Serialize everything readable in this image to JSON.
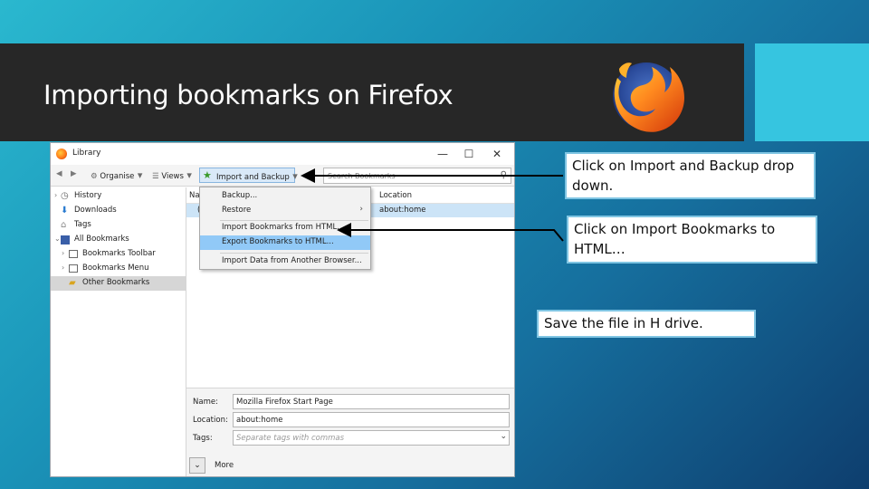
{
  "slide": {
    "title": "Importing bookmarks on Firefox"
  },
  "window": {
    "title": "Library",
    "controls": {
      "minimize": "—",
      "maximize": "☐",
      "close": "✕"
    },
    "toolbar": {
      "back": "◀",
      "forward": "▶",
      "organise_label": "Organise",
      "views_label": "Views",
      "import_label": "Import and Backup",
      "search_placeholder": "Search Bookmarks"
    },
    "sidebar": {
      "items": [
        {
          "label": "History"
        },
        {
          "label": "Downloads"
        },
        {
          "label": "Tags"
        },
        {
          "label": "All Bookmarks"
        },
        {
          "label": "Bookmarks Toolbar"
        },
        {
          "label": "Bookmarks Menu"
        },
        {
          "label": "Other Bookmarks"
        }
      ]
    },
    "list": {
      "col_name": "Na",
      "col_location": "Location",
      "row_name": "(",
      "row_location": "about:home"
    },
    "menu": {
      "items": [
        {
          "label": "Backup..."
        },
        {
          "label": "Restore"
        },
        {
          "label": "Import Bookmarks from HTML..."
        },
        {
          "label": "Export Bookmarks to HTML..."
        },
        {
          "label": "Import Data from Another Browser..."
        }
      ],
      "submenu_arrow": "›"
    },
    "details": {
      "name_label": "Name:",
      "name_value": "Mozilla Firefox Start Page",
      "location_label": "Location:",
      "location_value": "about:home",
      "tags_label": "Tags:",
      "tags_placeholder": "Separate tags with commas",
      "more_label": "More"
    }
  },
  "callouts": {
    "c1": "Click on Import and Backup drop down.",
    "c2": "Click on Import Bookmarks to HTML…",
    "c3": "Save the file in H drive."
  },
  "colors": {
    "title_bar": "#272727",
    "accent": "#36c5e0",
    "callout_border": "#7fc5e3",
    "menu_highlight": "#91c9f7"
  }
}
